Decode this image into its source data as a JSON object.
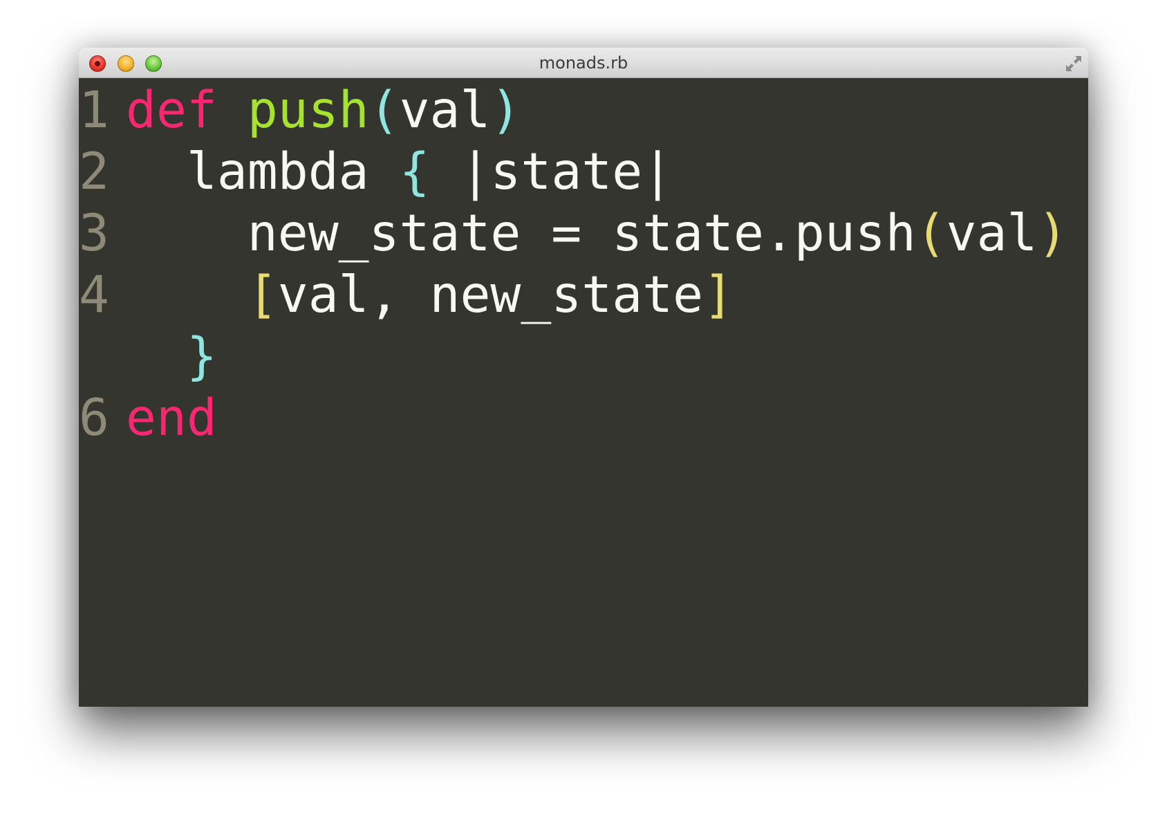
{
  "window": {
    "title": "monads.rb"
  },
  "colors": {
    "background": "#34352f",
    "line_number": "#8f8a78",
    "keyword": "#f92672",
    "function": "#a6e22e",
    "bracket_outer": "#8fe6e0",
    "bracket_inner": "#e6db74",
    "text": "#f8f8f2"
  },
  "icons": {
    "close": "close-icon",
    "minimize": "minimize-icon",
    "zoom": "zoom-icon",
    "fullscreen": "fullscreen-arrows-icon"
  },
  "editor": {
    "lines": [
      {
        "number": "1",
        "tokens": [
          "def",
          " ",
          "push",
          "(",
          "val",
          ")"
        ]
      },
      {
        "number": "2",
        "tokens": [
          "  lambda ",
          "{",
          " |state|"
        ]
      },
      {
        "number": "3",
        "tokens": [
          "    new_state = state.push",
          "(",
          "val",
          ")"
        ]
      },
      {
        "number": "4",
        "tokens": [
          "    ",
          "[",
          "val, new_state",
          "]"
        ]
      },
      {
        "number": "",
        "tokens": [
          "  ",
          "}"
        ]
      },
      {
        "number": "6",
        "tokens": [
          "end"
        ]
      }
    ]
  }
}
